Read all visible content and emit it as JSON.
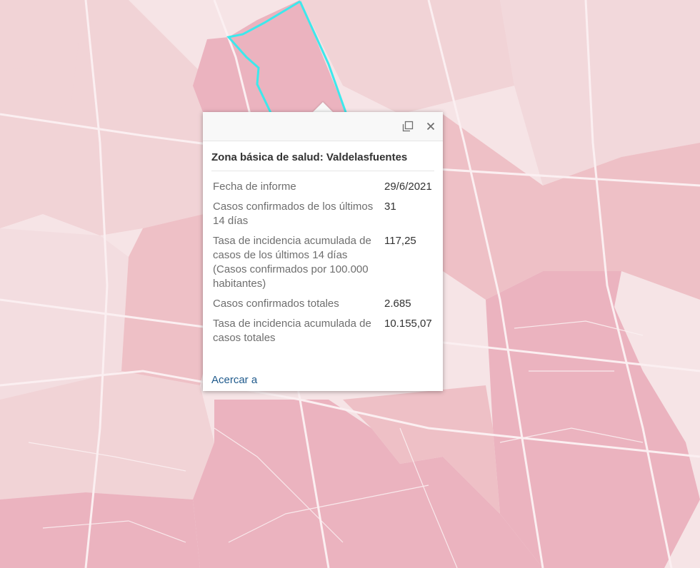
{
  "map": {
    "colors": {
      "background": "#f6e4e6",
      "light_fill": "#f1d3d6",
      "medium_fill": "#eec0c6",
      "dark_fill": "#ebb3bf",
      "selected_outline": "#3de8ec",
      "road": "#fbeff1"
    }
  },
  "popup": {
    "dock_icon": "dock-window-icon",
    "close_icon": "close-icon",
    "title": "Zona básica de salud: Valdelasfuentes",
    "rows": [
      {
        "label": "Fecha de informe",
        "value": "29/6/2021"
      },
      {
        "label": "Casos confirmados de los últimos 14 días",
        "value": "31"
      },
      {
        "label": "Tasa de incidencia acumulada de casos de los últimos 14 días (Casos confirmados por 100.000 habitantes)",
        "value": "117,25"
      },
      {
        "label": "Casos confirmados totales",
        "value": "2.685"
      },
      {
        "label": "Tasa de incidencia acumulada de casos totales",
        "value": "10.155,07"
      }
    ],
    "zoom_link": "Acercar a"
  }
}
